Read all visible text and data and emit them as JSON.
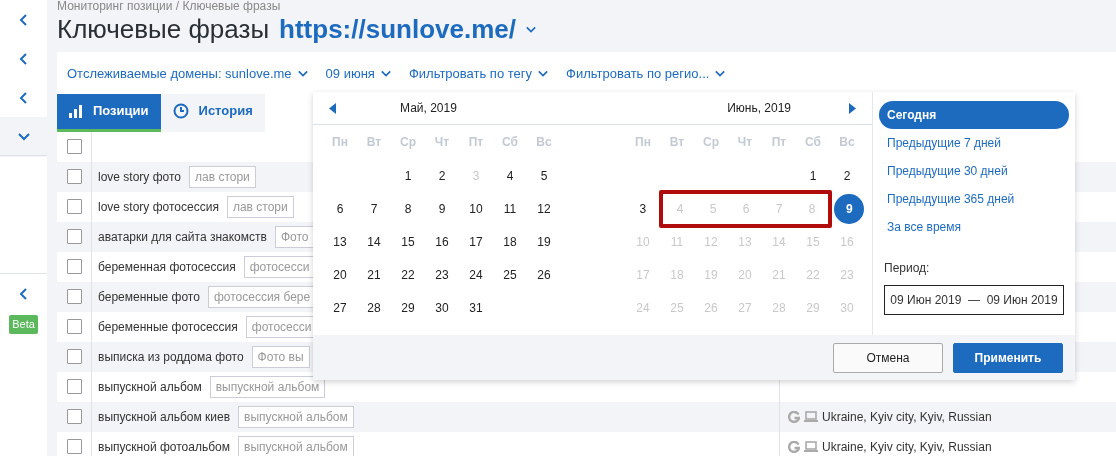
{
  "breadcrumb": "Мониторинг позиции / Ключевые фразы",
  "title": "Ключевые фразы",
  "site": "https://sunlove.me/",
  "sidebar": {
    "items": [
      {
        "kind": "collapse"
      },
      {
        "kind": "collapse"
      },
      {
        "kind": "collapse"
      },
      {
        "kind": "expand"
      },
      {
        "kind": "spacer"
      },
      {
        "kind": "collapse"
      }
    ],
    "badge": "Beta"
  },
  "filters": [
    {
      "label": "Отслеживаемые домены: sunlove.me"
    },
    {
      "label": "09 июня"
    },
    {
      "label": "Фильтровать по тегу"
    },
    {
      "label": "Фильтровать по регио..."
    }
  ],
  "tabs": [
    {
      "label": "Позиции",
      "kind": "bars",
      "selected": true
    },
    {
      "label": "История",
      "kind": "clock",
      "selected": false
    }
  ],
  "table": {
    "header_checked": false,
    "rows": [
      {
        "checked": false,
        "keyword": "love story фото",
        "tag": "лав стори"
      },
      {
        "checked": false,
        "keyword": "love story фотосессия",
        "tag": "лав стори"
      },
      {
        "checked": false,
        "keyword": "аватарки для сайта знакомств",
        "tag": "Фото"
      },
      {
        "checked": false,
        "keyword": "беременная фотосессия",
        "tag": "фотосесси"
      },
      {
        "checked": false,
        "keyword": "беременные фото",
        "tag": "фотосессия бере"
      },
      {
        "checked": false,
        "keyword": "беременные фотосессия",
        "tag": "фотосесси"
      },
      {
        "checked": false,
        "keyword": "выписка из роддома фото",
        "tag": "Фото вы"
      },
      {
        "checked": false,
        "keyword": "выпускной альбом",
        "tag": "выпускной альбом"
      },
      {
        "checked": false,
        "keyword": "выпускной альбом киев",
        "tag": "выпускной альбом",
        "region": "Ukraine, Kyiv city, Kyiv, Russian"
      },
      {
        "checked": false,
        "keyword": "выпускной фотоальбом",
        "tag": "выпускной альбом",
        "region": "Ukraine, Kyiv city, Kyiv, Russian"
      }
    ]
  },
  "date_picker": {
    "months": [
      {
        "title": "Май, 2019",
        "kind": "prev",
        "weekdays": [
          "Пн",
          "Вт",
          "Ср",
          "Чт",
          "Пт",
          "Сб",
          "Вс"
        ],
        "weeks": [
          [
            {
              "d": "1",
              "muted": false
            },
            {
              "d": "2",
              "muted": false
            },
            {
              "d": "3",
              "muted": true
            },
            {
              "d": "4",
              "muted": false
            },
            {
              "d": "5",
              "muted": false
            }
          ],
          [
            {
              "d": "6",
              "muted": false
            },
            {
              "d": "7",
              "muted": false
            },
            {
              "d": "8",
              "muted": false
            },
            {
              "d": "9",
              "muted": false
            },
            {
              "d": "10",
              "muted": false
            },
            {
              "d": "11",
              "muted": false
            },
            {
              "d": "12",
              "muted": false
            }
          ],
          [
            {
              "d": "13",
              "muted": false
            },
            {
              "d": "14",
              "muted": false
            },
            {
              "d": "15",
              "muted": false
            },
            {
              "d": "16",
              "muted": false
            },
            {
              "d": "17",
              "muted": false
            },
            {
              "d": "18",
              "muted": false
            },
            {
              "d": "19",
              "muted": false
            }
          ],
          [
            {
              "d": "20",
              "muted": false
            },
            {
              "d": "21",
              "muted": false
            },
            {
              "d": "22",
              "muted": false
            },
            {
              "d": "23",
              "muted": false
            },
            {
              "d": "24",
              "muted": false
            },
            {
              "d": "25",
              "muted": false
            },
            {
              "d": "26",
              "muted": false
            }
          ],
          [
            {
              "d": "27",
              "muted": false
            },
            {
              "d": "28",
              "muted": false
            },
            {
              "d": "29",
              "muted": false
            },
            {
              "d": "30",
              "muted": false
            },
            {
              "d": "31",
              "muted": false
            }
          ]
        ]
      },
      {
        "title": "Июнь, 2019",
        "kind": "next",
        "weekdays": [
          "Пн",
          "Вт",
          "Ср",
          "Чт",
          "Пт",
          "Сб",
          "Вс"
        ],
        "weeks": [
          [
            {
              "d": "1",
              "muted": false
            },
            {
              "d": "2",
              "muted": false
            }
          ],
          [
            {
              "d": "3",
              "muted": false
            },
            {
              "d": "4",
              "muted": true,
              "highlighted": true
            },
            {
              "d": "5",
              "muted": true,
              "highlighted": true
            },
            {
              "d": "6",
              "muted": true,
              "highlighted": true
            },
            {
              "d": "7",
              "muted": true,
              "highlighted": true
            },
            {
              "d": "8",
              "muted": true,
              "highlighted": true
            },
            {
              "d": "9",
              "muted": false,
              "selected": true
            }
          ],
          [
            {
              "d": "10",
              "muted": true
            },
            {
              "d": "11",
              "muted": true
            },
            {
              "d": "12",
              "muted": true
            },
            {
              "d": "13",
              "muted": true
            },
            {
              "d": "14",
              "muted": true
            },
            {
              "d": "15",
              "muted": true
            },
            {
              "d": "16",
              "muted": true
            }
          ],
          [
            {
              "d": "17",
              "muted": true
            },
            {
              "d": "18",
              "muted": true
            },
            {
              "d": "19",
              "muted": true
            },
            {
              "d": "20",
              "muted": true
            },
            {
              "d": "21",
              "muted": true
            },
            {
              "d": "22",
              "muted": true
            },
            {
              "d": "23",
              "muted": true
            }
          ],
          [
            {
              "d": "24",
              "muted": true
            },
            {
              "d": "25",
              "muted": true
            },
            {
              "d": "26",
              "muted": true
            },
            {
              "d": "27",
              "muted": true
            },
            {
              "d": "28",
              "muted": true
            },
            {
              "d": "29",
              "muted": true
            },
            {
              "d": "30",
              "muted": true
            }
          ]
        ]
      }
    ],
    "presets": [
      {
        "label": "Сегодня",
        "selected": true
      },
      {
        "label": "Предыдущие 7 дней",
        "selected": false
      },
      {
        "label": "Предыдущие 30 дней",
        "selected": false
      },
      {
        "label": "Предыдущие 365 дней",
        "selected": false
      },
      {
        "label": "За все время",
        "selected": false
      }
    ],
    "period_label": "Период:",
    "period_value": "09 Июн 2019  —  09 Июн 2019",
    "buttons": [
      {
        "label": "Отмена",
        "kind": "secondary"
      },
      {
        "label": "Применить",
        "kind": "primary"
      }
    ]
  }
}
